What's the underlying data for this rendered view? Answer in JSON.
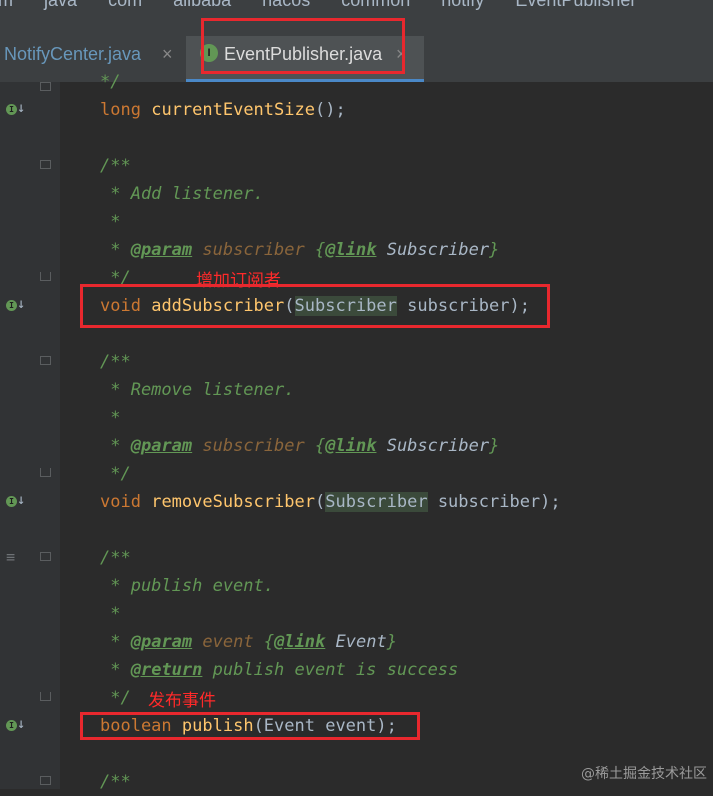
{
  "breadcrumb": [
    "m",
    "java",
    "com",
    "alibaba",
    "nacos",
    "common",
    "notify",
    "EventPublisher"
  ],
  "tabs": [
    {
      "label": "NotifyCenter.java",
      "close": "×"
    },
    {
      "label": "EventPublisher.java",
      "close": "×",
      "icon_letter": "I"
    }
  ],
  "code": {
    "l1_end": "*/",
    "l2_type": "long",
    "l2_fn": "currentEventSize",
    "l2_rest": "();",
    "c1_open": "/**",
    "c1_desc": " * Add listener.",
    "star": " *",
    "c1_param_tag": "@param",
    "c1_param_name": "subscriber",
    "c1_link_open": "{",
    "c1_link_tag": "@link",
    "c1_link_ref": "Subscriber",
    "c1_link_close": "}",
    "c1_close": "*/",
    "l_add_type": "void",
    "l_add_fn": "addSubscriber",
    "l_add_paren": "(",
    "l_add_ptype": "Subscriber",
    "l_add_rest": " subscriber);",
    "c2_open": "/**",
    "c2_desc": " * Remove listener.",
    "c2_param_tag": "@param",
    "c2_param_name": "subscriber",
    "c2_link_tag": "@link",
    "c2_link_ref": "Subscriber",
    "c2_close": "*/",
    "l_rem_type": "void",
    "l_rem_fn": "removeSubscriber",
    "l_rem_paren": "(",
    "l_rem_ptype": "Subscriber",
    "l_rem_rest": " subscriber);",
    "c3_open": "/**",
    "c3_desc": " * publish event.",
    "c3_param_tag": "@param",
    "c3_param_name": "event",
    "c3_link_tag": "@link",
    "c3_link_ref": "Event",
    "c3_return_tag": "@return",
    "c3_return_text": "publish event is success",
    "c3_close": "*/",
    "l_pub_type": "boolean",
    "l_pub_fn": "publish",
    "l_pub_rest": "(Event event);",
    "c4_open": "/**"
  },
  "annotations": {
    "add": "增加订阅者",
    "publish": "发布事件"
  },
  "watermark": "@稀土掘金技术社区",
  "icons": {
    "interface_method": "implemented-method-icon",
    "fold": "fold-icon",
    "structure": "list-icon"
  },
  "colors": {
    "highlight_box": "#e8282e",
    "keyword": "#cc7832",
    "method": "#ffc66d",
    "comment": "#629755"
  }
}
